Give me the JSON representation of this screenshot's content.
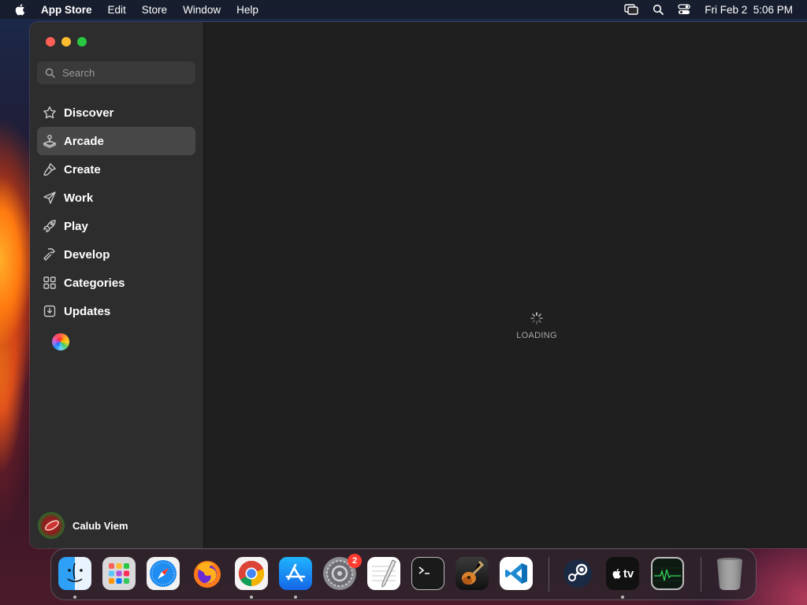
{
  "menubar": {
    "app_name": "App Store",
    "menus": [
      "Edit",
      "Store",
      "Window",
      "Help"
    ],
    "clock": "Fri Feb 2  5:06 PM"
  },
  "sidebar": {
    "search_placeholder": "Search",
    "items": [
      {
        "label": "Discover",
        "icon": "star-icon",
        "active": false
      },
      {
        "label": "Arcade",
        "icon": "joystick-icon",
        "active": true
      },
      {
        "label": "Create",
        "icon": "brush-icon",
        "active": false
      },
      {
        "label": "Work",
        "icon": "paper-plane-icon",
        "active": false
      },
      {
        "label": "Play",
        "icon": "rocket-icon",
        "active": false
      },
      {
        "label": "Develop",
        "icon": "hammer-icon",
        "active": false
      },
      {
        "label": "Categories",
        "icon": "grid-icon",
        "active": false
      },
      {
        "label": "Updates",
        "icon": "download-tray-icon",
        "active": false
      }
    ],
    "profile": {
      "name": "Calub Viem"
    }
  },
  "content": {
    "loading_label": "LOADING"
  },
  "dock": {
    "apps": [
      {
        "name": "Finder",
        "running": true
      },
      {
        "name": "Launchpad",
        "running": false
      },
      {
        "name": "Safari",
        "running": false
      },
      {
        "name": "Firefox",
        "running": false
      },
      {
        "name": "Chrome",
        "running": true
      },
      {
        "name": "App Store",
        "running": true
      },
      {
        "name": "System Settings",
        "running": false,
        "badge": "2"
      },
      {
        "name": "TextEdit",
        "running": false
      },
      {
        "name": "Terminal",
        "running": false
      },
      {
        "name": "GarageBand",
        "running": false
      },
      {
        "name": "Visual Studio Code",
        "running": false
      },
      {
        "name": "Steam",
        "running": false
      },
      {
        "name": "Apple TV",
        "running": true
      },
      {
        "name": "Activity Monitor",
        "running": false
      },
      {
        "name": "Trash",
        "running": false
      }
    ],
    "appletv_label": "tv"
  },
  "colors": {
    "close": "#fe5f57",
    "minimize": "#febc2e",
    "maximize": "#28c840",
    "sidebar_bg": "#2d2d2e",
    "content_bg": "#1f1f1f",
    "badge": "#ff3b30"
  }
}
